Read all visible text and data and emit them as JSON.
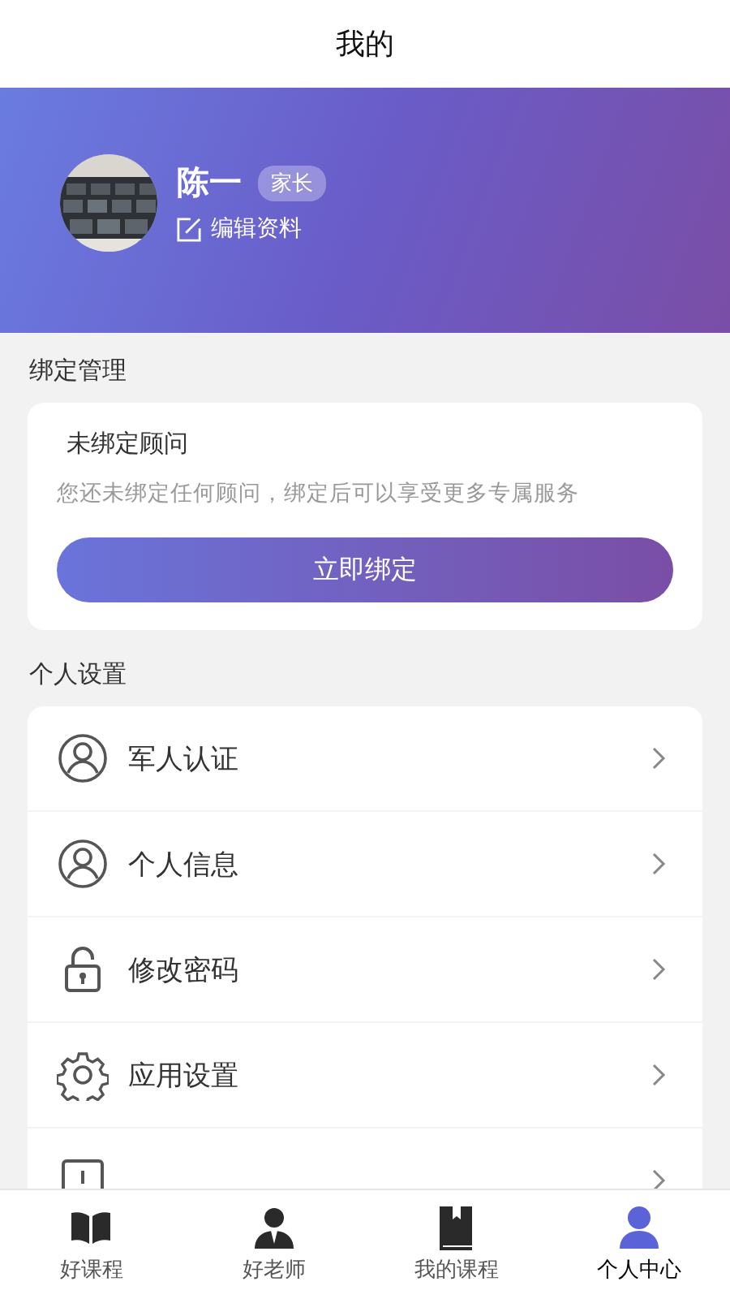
{
  "header": {
    "title": "我的"
  },
  "profile": {
    "name": "陈一",
    "role_badge": "家长",
    "edit_link": "编辑资料"
  },
  "binding": {
    "section_title": "绑定管理",
    "card_title": "未绑定顾问",
    "description": "您还未绑定任何顾问，绑定后可以享受更多专属服务",
    "button": "立即绑定"
  },
  "settings": {
    "section_title": "个人设置",
    "items": [
      {
        "kind": "person",
        "label": "军人认证"
      },
      {
        "kind": "person",
        "label": "个人信息"
      },
      {
        "kind": "lock",
        "label": "修改密码"
      },
      {
        "kind": "gear",
        "label": "应用设置"
      },
      {
        "kind": "exit"
      }
    ]
  },
  "tab_bar": [
    {
      "kind": "open-book",
      "label": "好课程",
      "selected": false
    },
    {
      "kind": "teacher",
      "label": "好老师",
      "selected": false
    },
    {
      "kind": "book",
      "label": "我的课程",
      "selected": false
    },
    {
      "kind": "user",
      "label": "个人中心",
      "selected": true
    }
  ]
}
